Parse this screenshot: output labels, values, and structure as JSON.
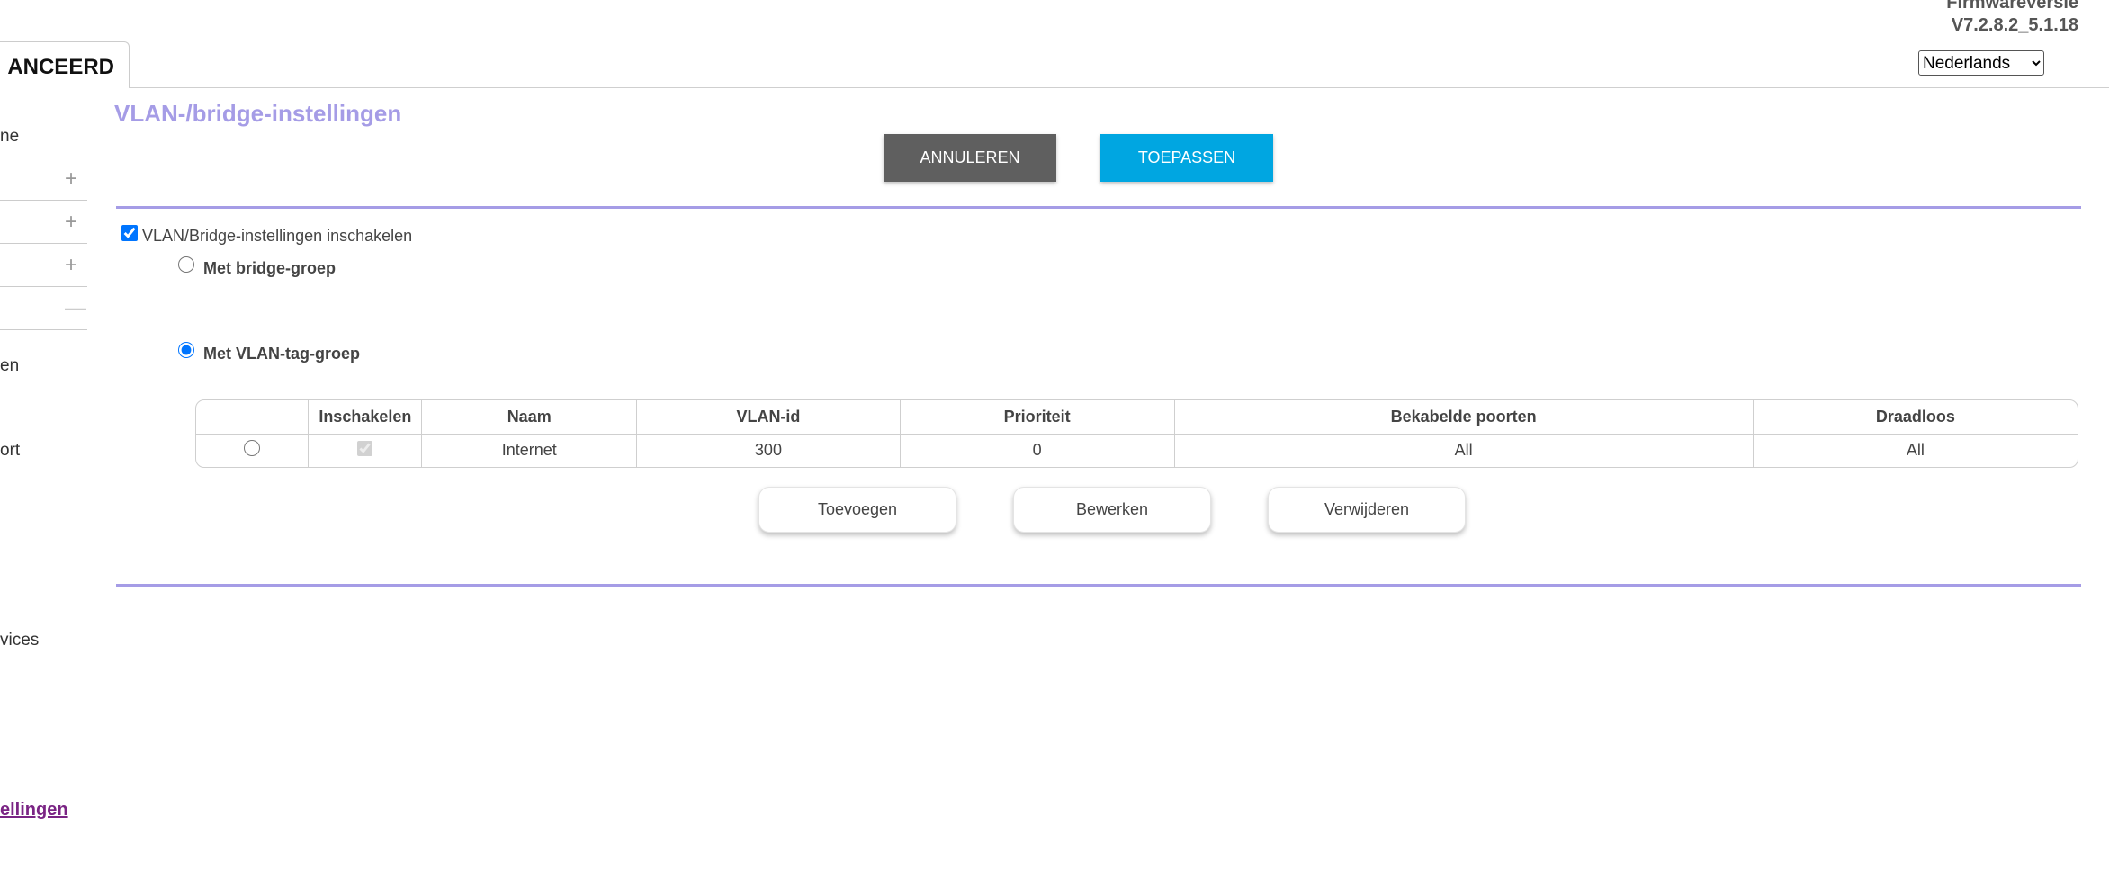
{
  "header": {
    "firmware_label": "Firmwareversie",
    "firmware_version": "V7.2.8.2_5.1.18",
    "tab_label": "ANCEERD",
    "language": {
      "selected": "Nederlands"
    }
  },
  "sidebar": {
    "items": [
      "ne",
      "en",
      "ort",
      "vices"
    ],
    "active_link": "ellingen",
    "expand_sign": "+",
    "collapse_sign": "—"
  },
  "page": {
    "title": "VLAN-/bridge-instellingen",
    "cancel_label": "ANNULEREN",
    "apply_label": "TOEPASSEN",
    "enable_label": "VLAN/Bridge-instellingen inschakelen",
    "bridge_group_label": "Met bridge-groep",
    "vlan_tag_group_label": "Met VLAN-tag-groep"
  },
  "table": {
    "headers": [
      "",
      "Inschakelen",
      "Naam",
      "VLAN-id",
      "Prioriteit",
      "Bekabelde poorten",
      "Draadloos"
    ],
    "rows": [
      {
        "name": "Internet",
        "vlan_id": "300",
        "priority": "0",
        "wired_ports": "All",
        "wireless": "All"
      }
    ]
  },
  "table_buttons": {
    "add": "Toevoegen",
    "edit": "Bewerken",
    "delete": "Verwijderen"
  },
  "colors": {
    "accent": "#a59ce6",
    "apply": "#00a6e1",
    "cancel": "#5f5f5f",
    "link": "#7a2484"
  }
}
